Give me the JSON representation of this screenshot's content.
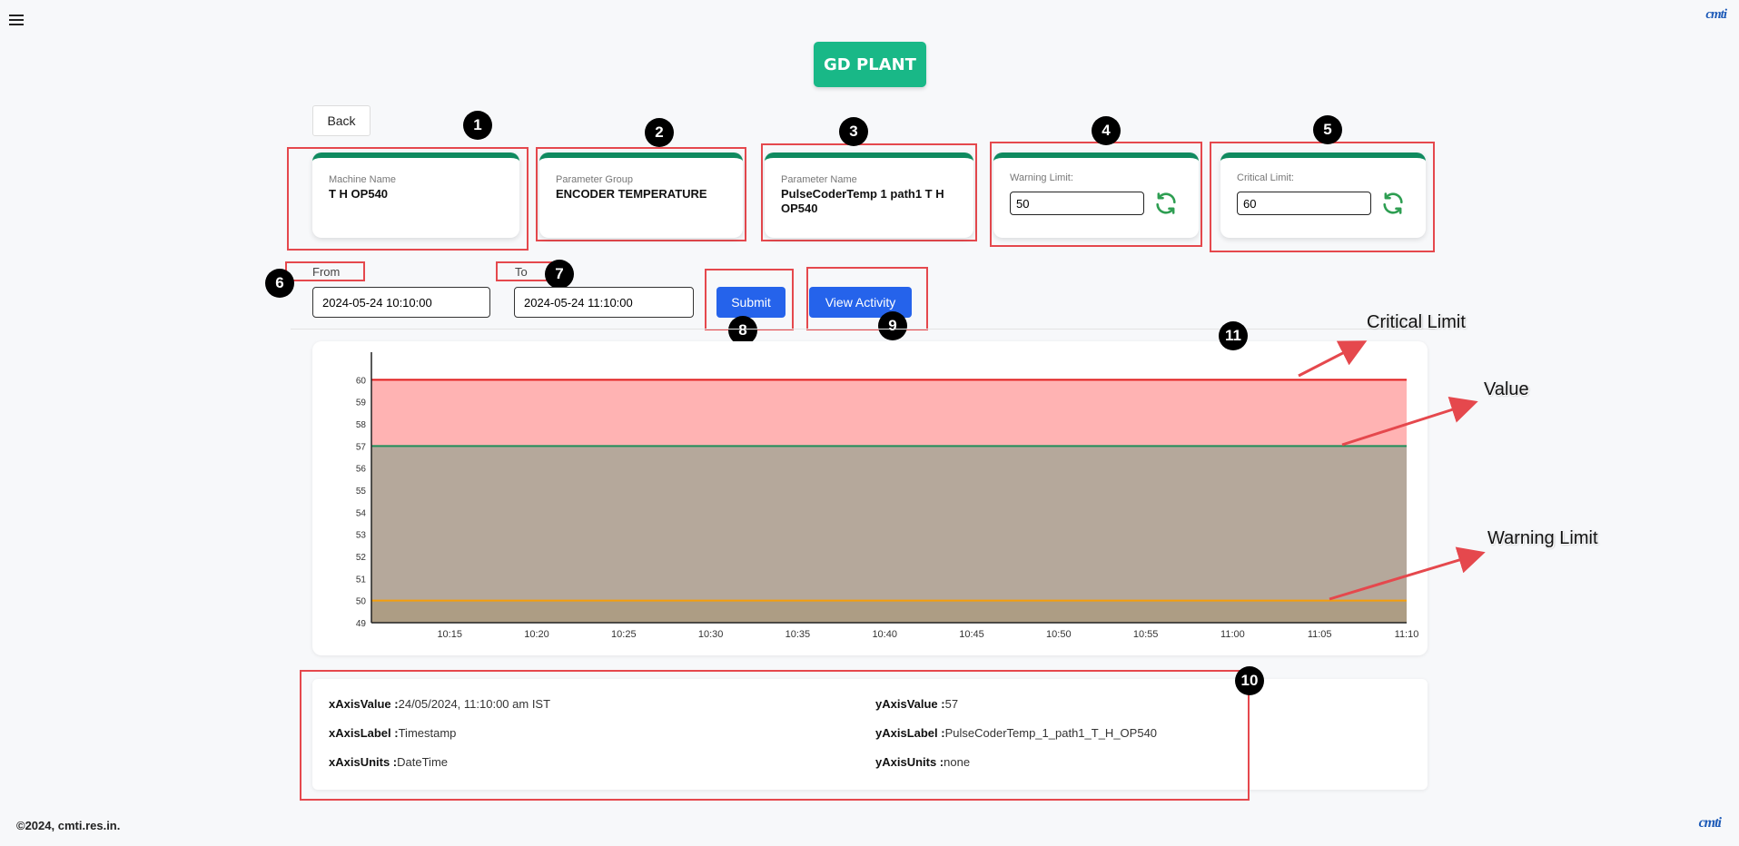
{
  "header": {
    "title": "GD PLANT",
    "logo_text": "cmti"
  },
  "back_label": "Back",
  "cards": {
    "machine": {
      "label": "Machine Name",
      "value": "T H OP540"
    },
    "group": {
      "label": "Parameter Group",
      "value": "ENCODER TEMPERATURE"
    },
    "param": {
      "label": "Parameter Name",
      "value": "PulseCoderTemp 1 path1 T H OP540"
    },
    "warning": {
      "label": "Warning Limit:",
      "value": "50"
    },
    "critical": {
      "label": "Critical Limit:",
      "value": "60"
    }
  },
  "filters": {
    "from_label": "From",
    "from_value": "2024-05-24 10:10:00",
    "to_label": "To",
    "to_value": "2024-05-24 11:10:00",
    "submit_label": "Submit",
    "view_activity_label": "View Activity"
  },
  "badges": [
    "1",
    "2",
    "3",
    "4",
    "5",
    "6",
    "7",
    "8",
    "9",
    "10",
    "11"
  ],
  "annotations": {
    "critical": "Critical Limit",
    "value": "Value",
    "warning": "Warning Limit"
  },
  "chart_data": {
    "type": "area",
    "x": [
      "10:15",
      "10:20",
      "10:25",
      "10:30",
      "10:35",
      "10:40",
      "10:45",
      "10:50",
      "10:55",
      "11:00",
      "11:05",
      "11:10"
    ],
    "yticks": [
      49,
      50,
      51,
      52,
      53,
      54,
      55,
      56,
      57,
      58,
      59,
      60
    ],
    "ylim": [
      49,
      61
    ],
    "xlim_minutes": [
      10.5,
      70
    ],
    "series": [
      {
        "name": "Critical Limit",
        "value": 60,
        "color": "#e11d1d",
        "fill": "#ffb3b3"
      },
      {
        "name": "Value",
        "value": 57,
        "color": "#1f8f5a",
        "fill": "#b5a89b"
      },
      {
        "name": "Warning Limit",
        "value": 50,
        "color": "#f59e0b",
        "fill": "#ad9d84"
      }
    ]
  },
  "info": {
    "x_value_label": "xAxisValue :",
    "x_value": "24/05/2024, 11:10:00 am IST",
    "x_label_label": "xAxisLabel :",
    "x_label": "Timestamp",
    "x_units_label": "xAxisUnits :",
    "x_units": "DateTime",
    "y_value_label": "yAxisValue :",
    "y_value": "57",
    "y_label_label": "yAxisLabel :",
    "y_label": "PulseCoderTemp_1_path1_T_H_OP540",
    "y_units_label": "yAxisUnits :",
    "y_units": "none"
  },
  "footer": "©2024, cmti.res.in."
}
